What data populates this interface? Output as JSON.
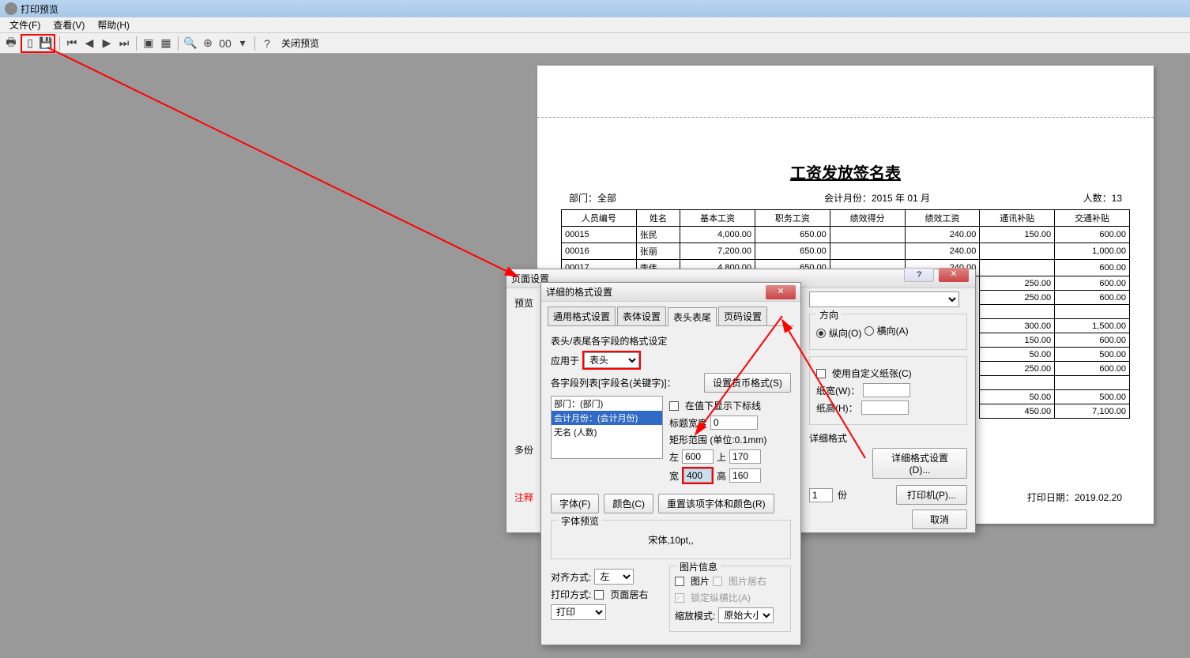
{
  "window": {
    "title": "打印预览"
  },
  "menu": {
    "file": "文件(F)",
    "view": "查看(V)",
    "help": "帮助(H)"
  },
  "toolbar": {
    "close_preview": "关闭预览",
    "zoom_combo": "00"
  },
  "report": {
    "title": "工资发放签名表",
    "dept_label": "部门：",
    "dept_value": "全部",
    "period_label": "会计月份：",
    "period_value": "2015 年 01 月",
    "count_label": "人数：",
    "count_value": "13",
    "columns": [
      "人员编号",
      "姓名",
      "基本工资",
      "职务工资",
      "绩效得分",
      "绩效工资",
      "通讯补贴",
      "交通补贴"
    ],
    "rows": [
      [
        "00015",
        "张民",
        "4,000.00",
        "650.00",
        "",
        "240.00",
        "150.00",
        "600.00"
      ],
      [
        "00016",
        "张丽",
        "7,200.00",
        "650.00",
        "",
        "240.00",
        "",
        "1,000.00"
      ],
      [
        "00017",
        "李伟",
        "4,800.00",
        "650.00",
        "",
        "240.00",
        "",
        "600.00"
      ]
    ],
    "right_cols_extra": [
      [
        "250.00",
        "600.00"
      ],
      [
        "250.00",
        "600.00"
      ],
      [
        "",
        ""
      ],
      [
        "300.00",
        "1,500.00"
      ],
      [
        "150.00",
        "600.00"
      ],
      [
        "50.00",
        "500.00"
      ],
      [
        "250.00",
        "600.00"
      ],
      [
        "",
        ""
      ],
      [
        "50.00",
        "500.00"
      ],
      [
        "450.00",
        "7,100.00"
      ]
    ],
    "print_date_label": "打印日期：",
    "print_date": "2019.02.20"
  },
  "page_setup": {
    "title": "页面设置",
    "preview_group": "预览",
    "multi_label": "多份",
    "note_prefix": "注释",
    "direction_group": "方向",
    "portrait": "纵向(O)",
    "landscape": "横向(A)",
    "custom_paper": "使用自定义纸张(C)",
    "paper_w": "纸宽(W)：",
    "paper_h": "纸高(H)：",
    "detail_group": "详细格式",
    "detail_btn": "详细格式设置(D)...",
    "copies": "1",
    "copies_unit": "份",
    "printer_btn": "打印机(P)...",
    "cancel_btn": "取消"
  },
  "detail": {
    "title": "详细的格式设置",
    "tabs": {
      "general": "通用格式设置",
      "body": "表体设置",
      "header_footer": "表头表尾",
      "page_num": "页码设置"
    },
    "section_label": "表头/表尾各字段的格式设定",
    "apply_to": "应用于",
    "apply_value": "表头",
    "field_list_label": "各字段列表[字段名(关键字)]：",
    "currency_btn": "设置货币格式(S)",
    "fields": {
      "dept": "部门：(部门)",
      "period": "会计月份：(会计月份)",
      "noname": "无名 (人数)"
    },
    "show_underline": "在值下显示下标线",
    "title_width_label": "标题宽度",
    "title_width_value": "0",
    "rect_group": "矩形范围 (单位:0.1mm)",
    "left": "左",
    "left_v": "600",
    "top": "上",
    "top_v": "170",
    "width": "宽",
    "width_v": "400",
    "height": "高",
    "height_v": "160",
    "font_btn": "字体(F)",
    "color_btn": "颜色(C)",
    "reset_btn": "重置该项字体和颜色(R)",
    "font_preview_label": "字体预览",
    "font_preview": "宋体,10pt,,",
    "align_label": "对齐方式:",
    "align_value": "左",
    "print_mode_label": "打印方式:",
    "page_center": "页面居右",
    "print_value": "打印",
    "image_group": "图片信息",
    "is_image": "图片",
    "image_right": "图片居右",
    "lock_ratio": "锁定纵横比(A)",
    "zoom_mode": "缩放模式:",
    "zoom_value": "原始大小"
  }
}
